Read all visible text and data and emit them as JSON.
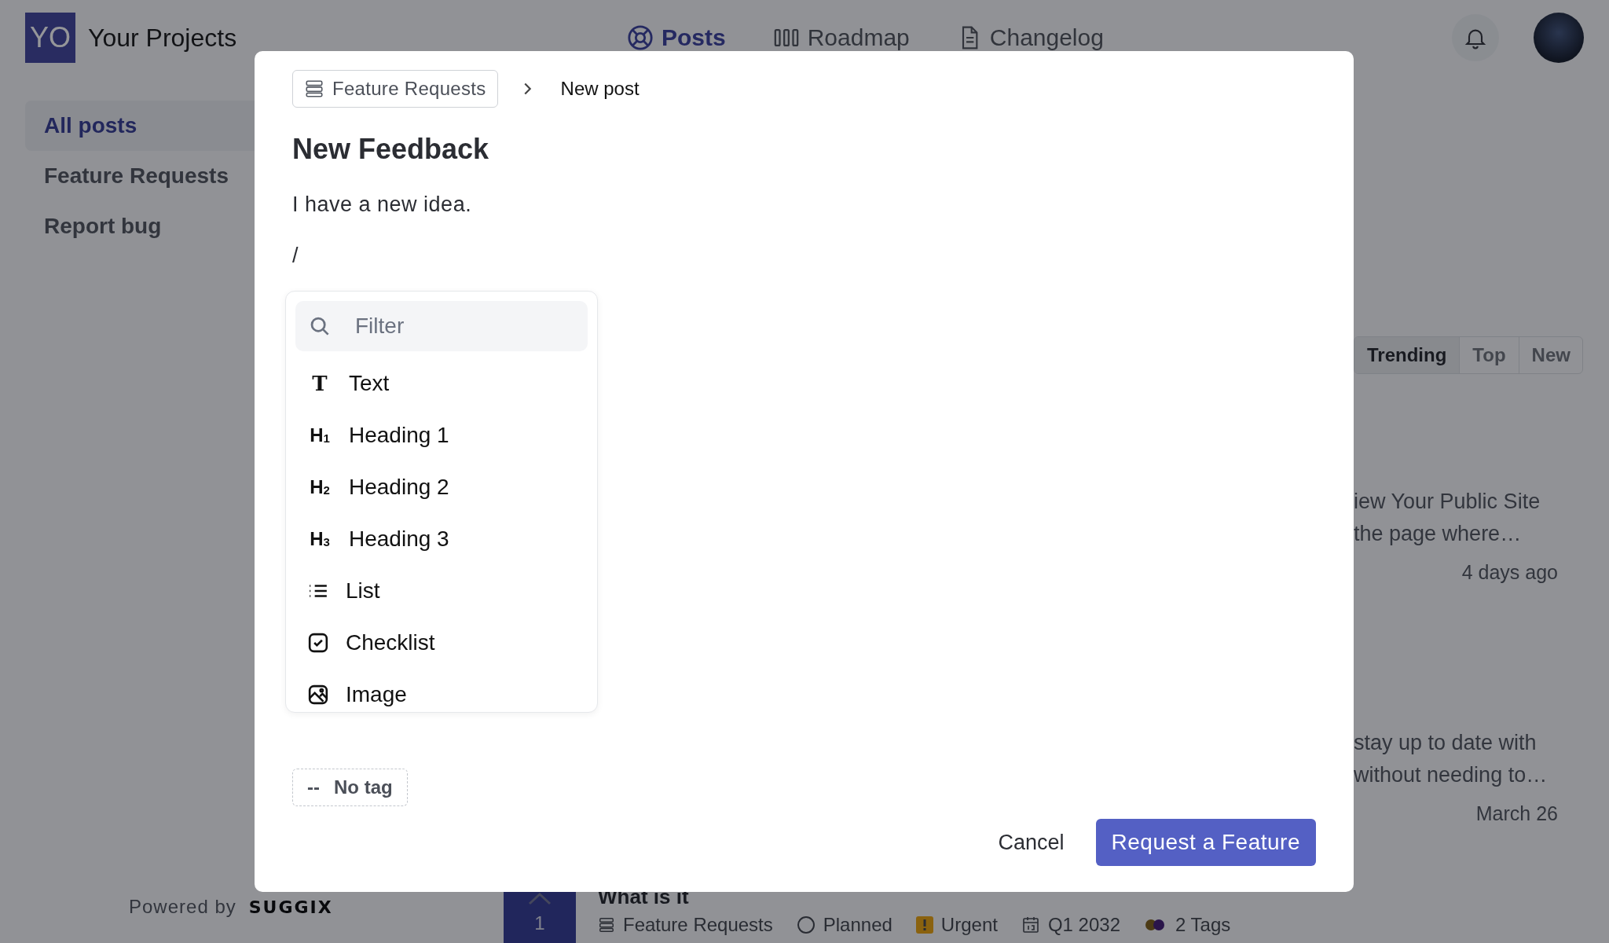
{
  "header": {
    "logo_text": "YO",
    "title": "Your Projects",
    "nav": [
      {
        "kind": "posts",
        "label": "Posts",
        "selected": true
      },
      {
        "kind": "roadmap",
        "label": "Roadmap",
        "selected": false
      },
      {
        "kind": "changelog",
        "label": "Changelog",
        "selected": false
      }
    ]
  },
  "sidebar": {
    "items": [
      {
        "label": "All posts",
        "selected": true
      },
      {
        "label": "Feature Requests",
        "selected": false
      },
      {
        "label": "Report bug",
        "selected": false
      }
    ],
    "powered_by": "Powered by",
    "brand": "SUGGIX"
  },
  "sort_tabs": [
    {
      "label": "Trending",
      "selected": true
    },
    {
      "label": "Top",
      "selected": false
    },
    {
      "label": "New",
      "selected": false
    }
  ],
  "posts": [
    {
      "lines": [
        "iew Your Public Site",
        "the page where…"
      ],
      "date": "4 days ago"
    },
    {
      "lines": [
        "stay up to date with",
        "without needing to…"
      ],
      "date": "March 26"
    }
  ],
  "bottom_post": {
    "votes": "1",
    "title": "What is it",
    "meta": [
      {
        "kind": "board",
        "label": "Feature Requests"
      },
      {
        "kind": "status",
        "label": "Planned"
      },
      {
        "kind": "priority",
        "label": "Urgent",
        "color": "#8a620f"
      },
      {
        "kind": "date",
        "label": "Q1 2032"
      },
      {
        "kind": "tags",
        "label": "2 Tags"
      }
    ]
  },
  "modal": {
    "breadcrumb": {
      "board": "Feature Requests",
      "current": "New post"
    },
    "title": "New Feedback",
    "body_lines": [
      "I have a new idea.",
      "/"
    ],
    "menu": {
      "placeholder": "Filter",
      "items": [
        {
          "kind": "text",
          "icon_text": "T",
          "label": "Text"
        },
        {
          "kind": "heading",
          "icon_text": "H$_{1}$",
          "label": "Heading 1"
        },
        {
          "kind": "heading",
          "icon_text": "H$_{2}$",
          "label": "Heading 2"
        },
        {
          "kind": "heading",
          "icon_text": "H$_{3}$",
          "label": "Heading 3"
        },
        {
          "kind": "list",
          "label": "List"
        },
        {
          "kind": "checklist",
          "label": "Checklist"
        },
        {
          "kind": "image",
          "label": "Image"
        }
      ]
    },
    "tag": {
      "prefix": "--",
      "label": "No tag"
    },
    "buttons": {
      "cancel": "Cancel",
      "submit": "Request a Feature"
    }
  }
}
